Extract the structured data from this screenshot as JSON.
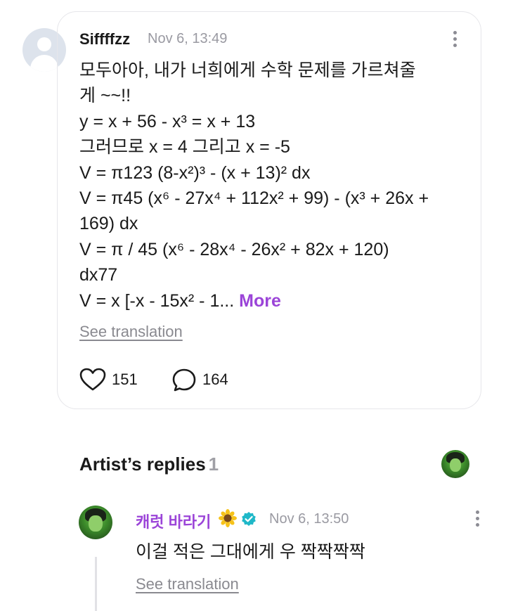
{
  "comment": {
    "username": "Siffffzz",
    "timestamp": "Nov 6, 13:49",
    "body_lines": [
      "모두아아, 내가 너희에게 수학 문제를 가르쳐줄",
      "게 ~~!!",
      "y = x + 56 - x³ = x + 13",
      "그러므로 x = 4 그리고 x = -5",
      "V = π123 (8-x²)³ - (x + 13)² dx",
      "V = π45 (x⁶ - 27x⁴ + 112x² + 99) - (x³ + 26x +",
      "169) dx",
      "V = π / 45 (x⁶ - 28x⁴ - 26x² + 82x + 120)",
      "dx77"
    ],
    "last_line": "V = x [-x - 15x² - 1...",
    "more_label": "More",
    "see_translation": "See translation",
    "likes": "151",
    "replies": "164"
  },
  "artist_section": {
    "title": "Artist’s replies",
    "count": "1"
  },
  "reply": {
    "name": "캐럿 바라기",
    "timestamp": "Nov 6, 13:50",
    "text": "이걸 적은 그대에게 우 짝짝짝짝",
    "see_translation": "See translation"
  },
  "colors": {
    "accent_purple": "#9b44d8",
    "verified_teal": "#1fb8c8",
    "muted_gray": "#9a9aa2"
  },
  "icons": {
    "like": "heart-outline-icon",
    "comment": "speech-bubble-icon",
    "more_options": "kebab-menu-icon",
    "verified": "verified-badge-icon",
    "emoji": "sunflower-emoji"
  }
}
